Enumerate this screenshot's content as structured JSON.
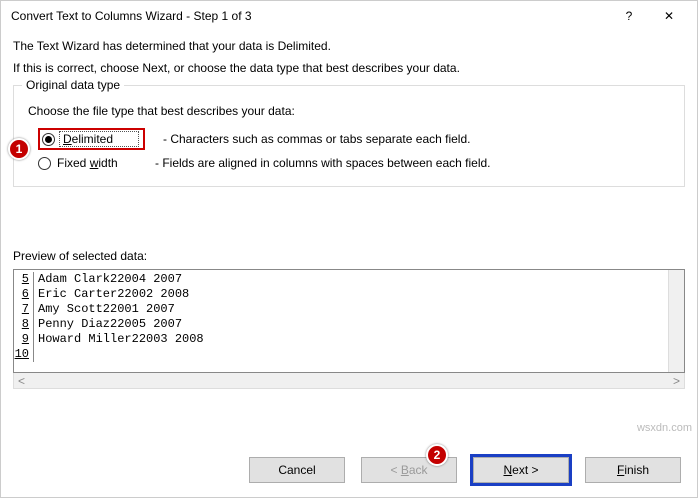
{
  "titlebar": {
    "title": "Convert Text to Columns Wizard - Step 1 of 3",
    "help": "?",
    "close": "✕"
  },
  "intro": {
    "line1": "The Text Wizard has determined that your data is Delimited.",
    "line2": "If this is correct, choose Next, or choose the data type that best describes your data."
  },
  "fieldset": {
    "legend": "Original data type",
    "choose": "Choose the file type that best describes your data:",
    "options": [
      {
        "label_pre": "D",
        "label_rest": "elimited",
        "desc": "- Characters such as commas or tabs separate each field.",
        "selected": true
      },
      {
        "label_pre": "Fixed ",
        "label_u": "w",
        "label_post": "idth",
        "desc": "- Fields are aligned in columns with spaces between each field.",
        "selected": false
      }
    ]
  },
  "preview": {
    "label": "Preview of selected data:",
    "rows": [
      {
        "n": "5",
        "t": "Adam Clark22004 2007"
      },
      {
        "n": "6",
        "t": "Eric Carter22002 2008"
      },
      {
        "n": "7",
        "t": "Amy Scott22001 2007"
      },
      {
        "n": "8",
        "t": "Penny Diaz22005 2007"
      },
      {
        "n": "9",
        "t": "Howard Miller22003 2008"
      },
      {
        "n": "10",
        "t": ""
      }
    ]
  },
  "buttons": {
    "cancel": "Cancel",
    "back": "< Back",
    "next": "Next >",
    "finish": "Finish"
  },
  "callouts": {
    "one": "1",
    "two": "2"
  },
  "watermark": "wsxdn.com",
  "hscroll": {
    "left": "<",
    "right": ">"
  }
}
